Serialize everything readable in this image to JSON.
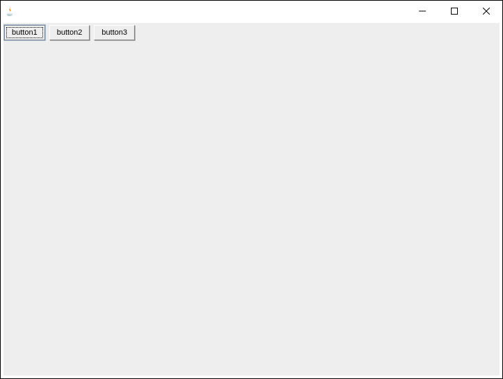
{
  "window": {
    "title": ""
  },
  "buttons": [
    {
      "label": "button1",
      "focused": true
    },
    {
      "label": "button2",
      "focused": false
    },
    {
      "label": "button3",
      "focused": false
    }
  ]
}
